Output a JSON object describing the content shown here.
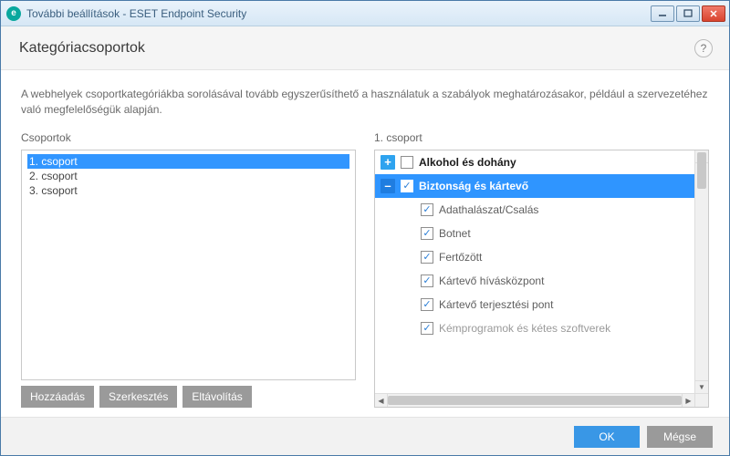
{
  "window": {
    "title": "További beállítások - ESET Endpoint Security",
    "logo_letter": "e"
  },
  "header": {
    "title": "Kategóriacsoportok",
    "help_symbol": "?"
  },
  "description": "A webhelyek csoportkategóriákba sorolásával tovább egyszerűsíthető a használatuk a szabályok meghatározásakor, például a szervezetéhez való megfelelőségük alapján.",
  "left": {
    "label": "Csoportok",
    "items": [
      "1. csoport",
      "2. csoport",
      "3. csoport"
    ],
    "selected_index": 0,
    "buttons": {
      "add": "Hozzáadás",
      "edit": "Szerkesztés",
      "remove": "Eltávolítás"
    }
  },
  "right": {
    "label": "1. csoport",
    "tree": [
      {
        "kind": "parent",
        "expander": "plus",
        "checked": false,
        "label": "Alkohol és dohány",
        "bold": true
      },
      {
        "kind": "parent",
        "expander": "minus",
        "checked": true,
        "label": "Biztonság és kártevő",
        "bold": true,
        "selected": true
      },
      {
        "kind": "child",
        "checked": true,
        "label": "Adathalászat/Csalás"
      },
      {
        "kind": "child",
        "checked": true,
        "label": "Botnet"
      },
      {
        "kind": "child",
        "checked": true,
        "label": "Fertőzött"
      },
      {
        "kind": "child",
        "checked": true,
        "label": "Kártevő hívásközpont"
      },
      {
        "kind": "child",
        "checked": true,
        "label": "Kártevő terjesztési pont"
      },
      {
        "kind": "child",
        "checked": true,
        "label": "Kémprogramok és kétes szoftverek",
        "dim": true
      }
    ]
  },
  "footer": {
    "ok": "OK",
    "cancel": "Mégse"
  }
}
